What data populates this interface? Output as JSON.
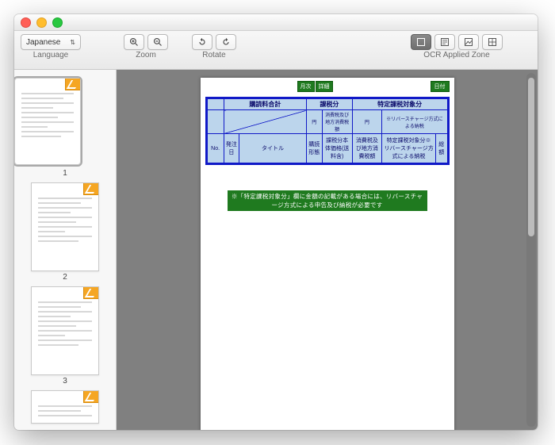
{
  "traffic": {
    "close": "close",
    "min": "minimize",
    "max": "maximize"
  },
  "toolbar": {
    "language": {
      "value": "Japanese",
      "caption": "Language"
    },
    "zoom": {
      "caption": "Zoom"
    },
    "rotate": {
      "caption": "Rotate"
    },
    "ocr": {
      "caption": "OCR Applied Zone"
    }
  },
  "thumbs": [
    "1",
    "2",
    "3"
  ],
  "doc": {
    "tabs": [
      "月次",
      "詳細"
    ],
    "stamp": "日付",
    "header": {
      "c1": "購読料合計",
      "c2": "課税分",
      "c3": "特定課税対象分",
      "unit": "円",
      "sub1": "消費税及び地方消費税額",
      "sub2": "※リバースチャージ方式による納税"
    },
    "row": {
      "no": "No.",
      "r1": "発注日",
      "r2": "タイトル",
      "r3": "購読形態",
      "r4": "課税分本体価格(送料含)",
      "r5": "消費税及び地方消費税額",
      "r6": "特定課税対象分※リバースチャージ方式による納税",
      "r7": "総額"
    },
    "footer": "※「特定課税対象分」欄に金額の記載がある場合には、リバースチャージ方式による申告及び納税が必要です"
  }
}
